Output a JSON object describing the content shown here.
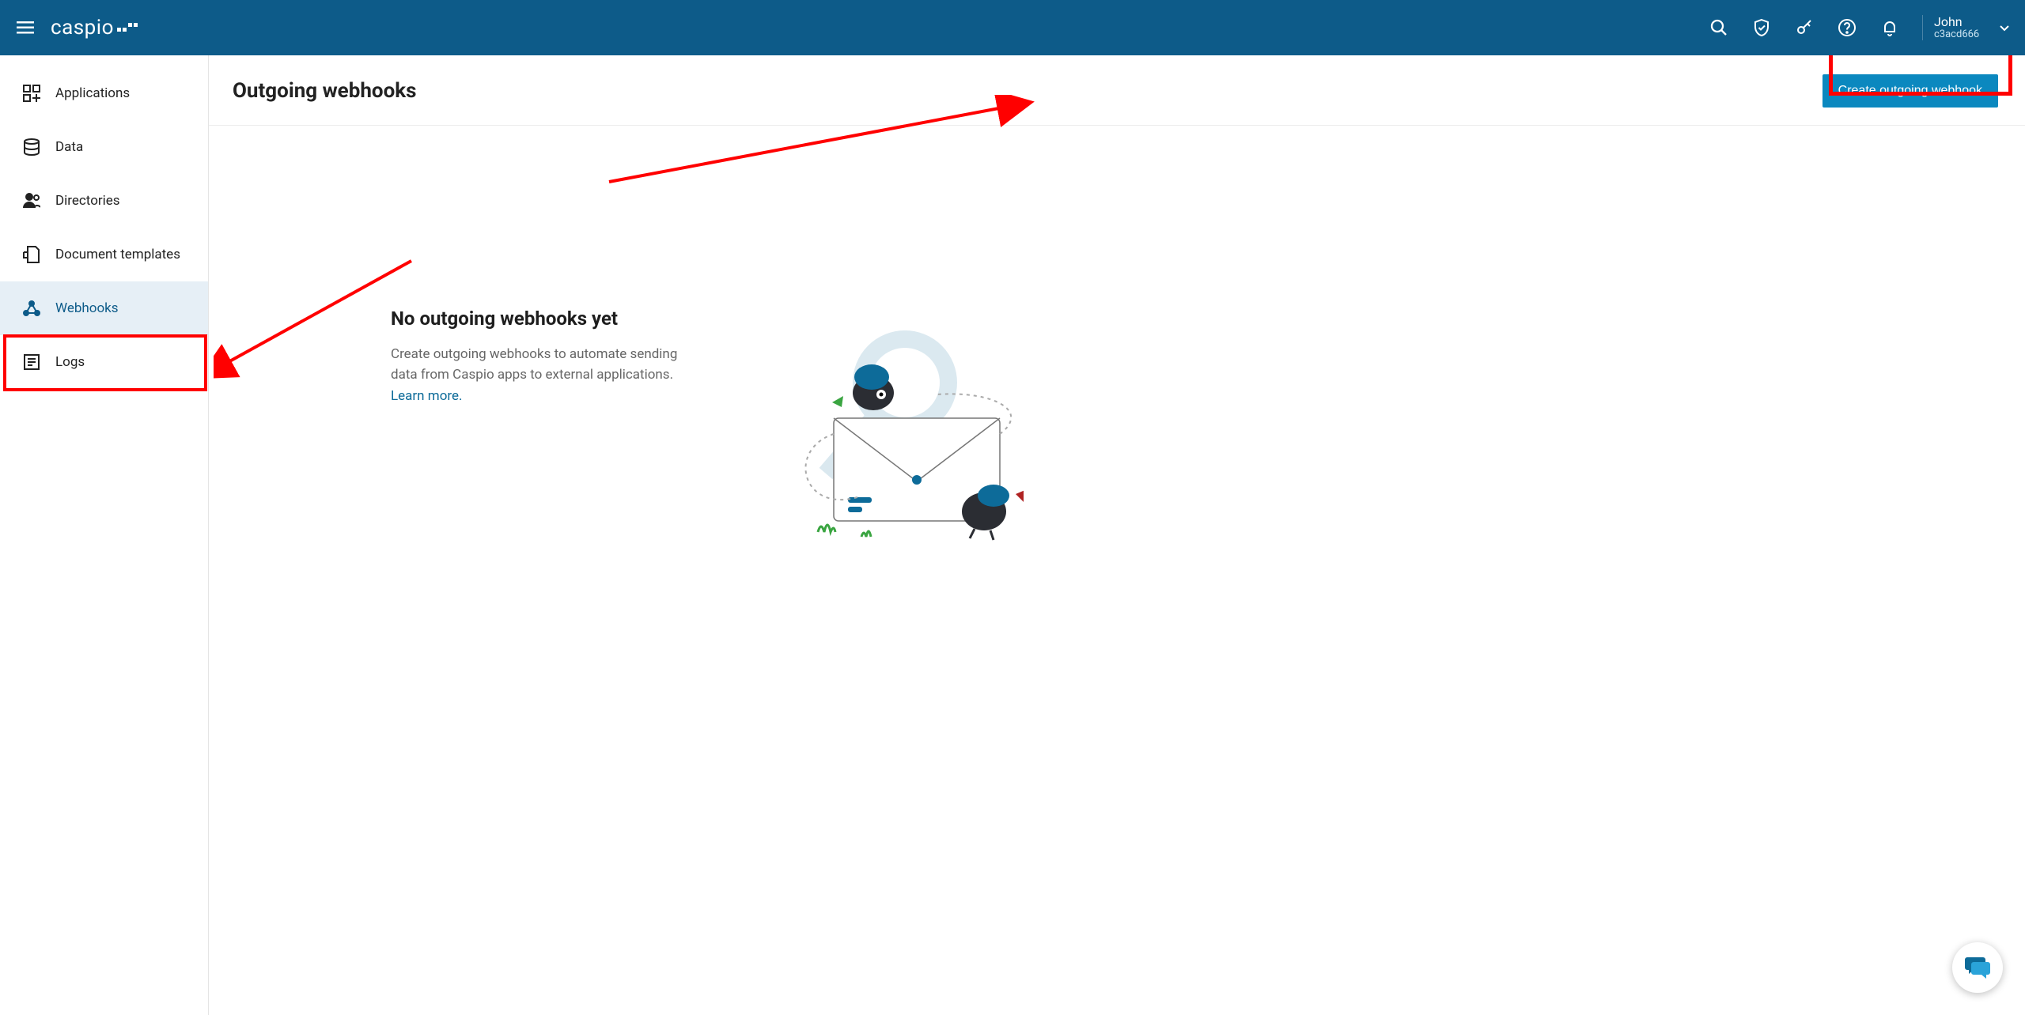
{
  "header": {
    "user_name": "John",
    "user_id": "c3acd666"
  },
  "sidebar": {
    "items": [
      {
        "label": "Applications"
      },
      {
        "label": "Data"
      },
      {
        "label": "Directories"
      },
      {
        "label": "Document templates"
      },
      {
        "label": "Webhooks"
      },
      {
        "label": "Logs"
      }
    ]
  },
  "main": {
    "title": "Outgoing webhooks",
    "create_button": "Create outgoing webhook",
    "empty_title": "No outgoing webhooks yet",
    "empty_desc": "Create outgoing webhooks to automate sending data from Caspio apps to external applications. ",
    "learn_more": "Learn more."
  }
}
